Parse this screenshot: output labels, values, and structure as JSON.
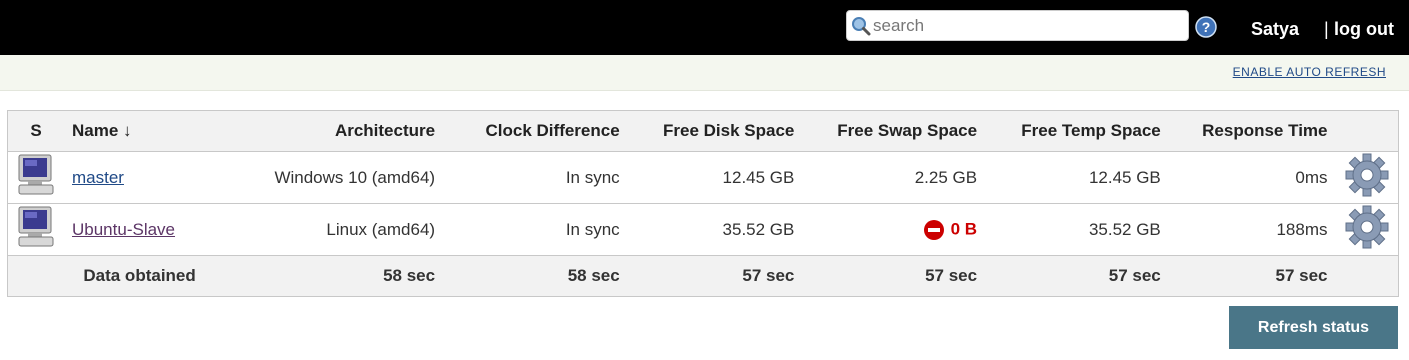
{
  "header": {
    "search_placeholder": "search",
    "user": "Satya",
    "logout_sep": "|",
    "logout": "log out"
  },
  "subbar": {
    "auto_refresh": "ENABLE AUTO REFRESH"
  },
  "table": {
    "columns": {
      "status": "S",
      "name": "Name ↓",
      "architecture": "Architecture",
      "clock": "Clock Difference",
      "disk": "Free Disk Space",
      "swap": "Free Swap Space",
      "temp": "Free Temp Space",
      "response": "Response Time"
    },
    "rows": [
      {
        "name": "master",
        "architecture": "Windows 10 (amd64)",
        "clock": "In sync",
        "disk": "12.45 GB",
        "swap": "2.25 GB",
        "temp": "12.45 GB",
        "response": "0ms"
      },
      {
        "name": "Ubuntu-Slave",
        "architecture": "Linux (amd64)",
        "clock": "In sync",
        "disk": "35.52 GB",
        "swap": "0 B",
        "temp": "35.52 GB",
        "response": "188ms"
      }
    ],
    "footer": {
      "label": "Data obtained",
      "architecture": "58 sec",
      "clock": "58 sec",
      "disk": "57 sec",
      "swap": "57 sec",
      "temp": "57 sec",
      "response": "57 sec"
    }
  },
  "actions": {
    "refresh": "Refresh status"
  },
  "colors": {
    "header_bg": "#000000",
    "link": "#204a87",
    "warning": "#cc0000",
    "button": "#4a7688"
  },
  "icons": [
    "search-icon",
    "help-icon",
    "computer-icon",
    "gear-icon",
    "error-icon"
  ]
}
